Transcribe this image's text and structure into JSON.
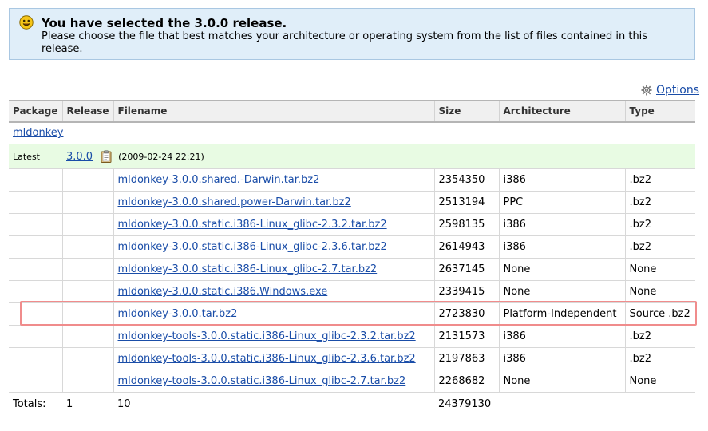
{
  "notice": {
    "title": "You have selected the 3.0.0 release.",
    "message": "Please choose the file that best matches your architecture or operating system from the list of files contained in this release."
  },
  "options_label": "Options",
  "columns": [
    "Package",
    "Release",
    "Filename",
    "Size",
    "Architecture",
    "Type"
  ],
  "package_name": "mldonkey",
  "latest": {
    "label": "Latest",
    "release": "3.0.0",
    "date": "(2009-02-24 22:21)"
  },
  "files": [
    {
      "name": "mldonkey-3.0.0.shared.-Darwin.tar.bz2",
      "size": "2354350",
      "arch": "i386",
      "type": ".bz2"
    },
    {
      "name": "mldonkey-3.0.0.shared.power-Darwin.tar.bz2",
      "size": "2513194",
      "arch": "PPC",
      "type": ".bz2"
    },
    {
      "name": "mldonkey-3.0.0.static.i386-Linux_glibc-2.3.2.tar.bz2",
      "size": "2598135",
      "arch": "i386",
      "type": ".bz2"
    },
    {
      "name": "mldonkey-3.0.0.static.i386-Linux_glibc-2.3.6.tar.bz2",
      "size": "2614943",
      "arch": "i386",
      "type": ".bz2"
    },
    {
      "name": "mldonkey-3.0.0.static.i386-Linux_glibc-2.7.tar.bz2",
      "size": "2637145",
      "arch": "None",
      "type": "None"
    },
    {
      "name": "mldonkey-3.0.0.static.i386.Windows.exe",
      "size": "2339415",
      "arch": "None",
      "type": "None"
    },
    {
      "name": "mldonkey-3.0.0.tar.bz2",
      "size": "2723830",
      "arch": "Platform-Independent",
      "type": "Source .bz2"
    },
    {
      "name": "mldonkey-tools-3.0.0.static.i386-Linux_glibc-2.3.2.tar.bz2",
      "size": "2131573",
      "arch": "i386",
      "type": ".bz2"
    },
    {
      "name": "mldonkey-tools-3.0.0.static.i386-Linux_glibc-2.3.6.tar.bz2",
      "size": "2197863",
      "arch": "i386",
      "type": ".bz2"
    },
    {
      "name": "mldonkey-tools-3.0.0.static.i386-Linux_glibc-2.7.tar.bz2",
      "size": "2268682",
      "arch": "None",
      "type": "None"
    }
  ],
  "totals": {
    "label": "Totals:",
    "packages": "1",
    "files": "10",
    "size": "24379130"
  },
  "colors": {
    "notice_bg": "#e0eef9",
    "latest_bg": "#e8fbe3",
    "link": "#1a4da8",
    "highlight": "#f08c8c"
  },
  "icons": {
    "notice": "smiley-icon",
    "options": "gear-icon",
    "release_notes": "clipboard-icon"
  }
}
